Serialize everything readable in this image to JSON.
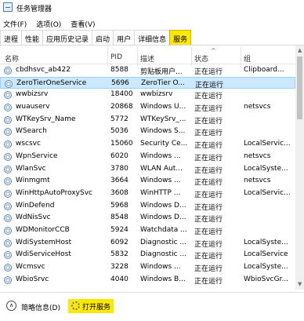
{
  "window": {
    "title": "任务管理器"
  },
  "menu": [
    "文件(F)",
    "选项(O)",
    "查看(V)"
  ],
  "tabs": [
    "进程",
    "性能",
    "应用历史记录",
    "启动",
    "用户",
    "详细信息",
    "服务"
  ],
  "active_tab": "服务",
  "columns": {
    "name": "名称",
    "pid": "PID",
    "desc": "描述",
    "status": "状态",
    "group": "组"
  },
  "services": [
    {
      "name": "cbdhsvc_ab422",
      "pid": "8588",
      "desc": "剪贴板用户...",
      "status": "正在运行",
      "group": "Clipboard..."
    },
    {
      "name": "ZeroTierOneService",
      "pid": "5696",
      "desc": "ZeroTier O...",
      "status": "正在运行",
      "group": ""
    },
    {
      "name": "wwbizsrv",
      "pid": "18400",
      "desc": "wwbizsrv",
      "status": "正在运行",
      "group": ""
    },
    {
      "name": "wuauserv",
      "pid": "20868",
      "desc": "Windows U...",
      "status": "正在运行",
      "group": "netsvcs"
    },
    {
      "name": "WTKeySrv_Name",
      "pid": "5772",
      "desc": "WTKeySrv_...",
      "status": "正在运行",
      "group": ""
    },
    {
      "name": "WSearch",
      "pid": "5036",
      "desc": "Windows S...",
      "status": "正在运行",
      "group": ""
    },
    {
      "name": "wscsvc",
      "pid": "15060",
      "desc": "Security Ce...",
      "status": "正在运行",
      "group": "LocalServic..."
    },
    {
      "name": "WpnService",
      "pid": "6020",
      "desc": "Windows ...",
      "status": "正在运行",
      "group": "netsvcs"
    },
    {
      "name": "WlanSvc",
      "pid": "3780",
      "desc": "WLAN Aut...",
      "status": "正在运行",
      "group": "LocalSyste..."
    },
    {
      "name": "Winmgmt",
      "pid": "3664",
      "desc": "Windows ...",
      "status": "正在运行",
      "group": "netsvcs"
    },
    {
      "name": "WinHttpAutoProxySvc",
      "pid": "3608",
      "desc": "WinHTTP ...",
      "status": "正在运行",
      "group": "LocalServic..."
    },
    {
      "name": "WinDefend",
      "pid": "5968",
      "desc": "Windows D...",
      "status": "正在运行",
      "group": ""
    },
    {
      "name": "WdNisSvc",
      "pid": "8548",
      "desc": "Windows D...",
      "status": "正在运行",
      "group": ""
    },
    {
      "name": "WDMonitorCCB",
      "pid": "5924",
      "desc": "Watchdata ...",
      "status": "正在运行",
      "group": ""
    },
    {
      "name": "WdiSystemHost",
      "pid": "6092",
      "desc": "Diagnostic ...",
      "status": "正在运行",
      "group": "LocalSyste..."
    },
    {
      "name": "WdiServiceHost",
      "pid": "5832",
      "desc": "Diagnostic ...",
      "status": "正在运行",
      "group": "LocalService"
    },
    {
      "name": "Wcmsvc",
      "pid": "3228",
      "desc": "Windows ...",
      "status": "正在运行",
      "group": "LocalSyste..."
    },
    {
      "name": "WbioSrvc",
      "pid": "4040",
      "desc": "Windows B...",
      "status": "正在运行",
      "group": "WbioSvcGr..."
    }
  ],
  "selected_service": "ZeroTierOneService",
  "footer": {
    "fewer_details": "简略信息(D)",
    "open_services": "打开服务"
  }
}
